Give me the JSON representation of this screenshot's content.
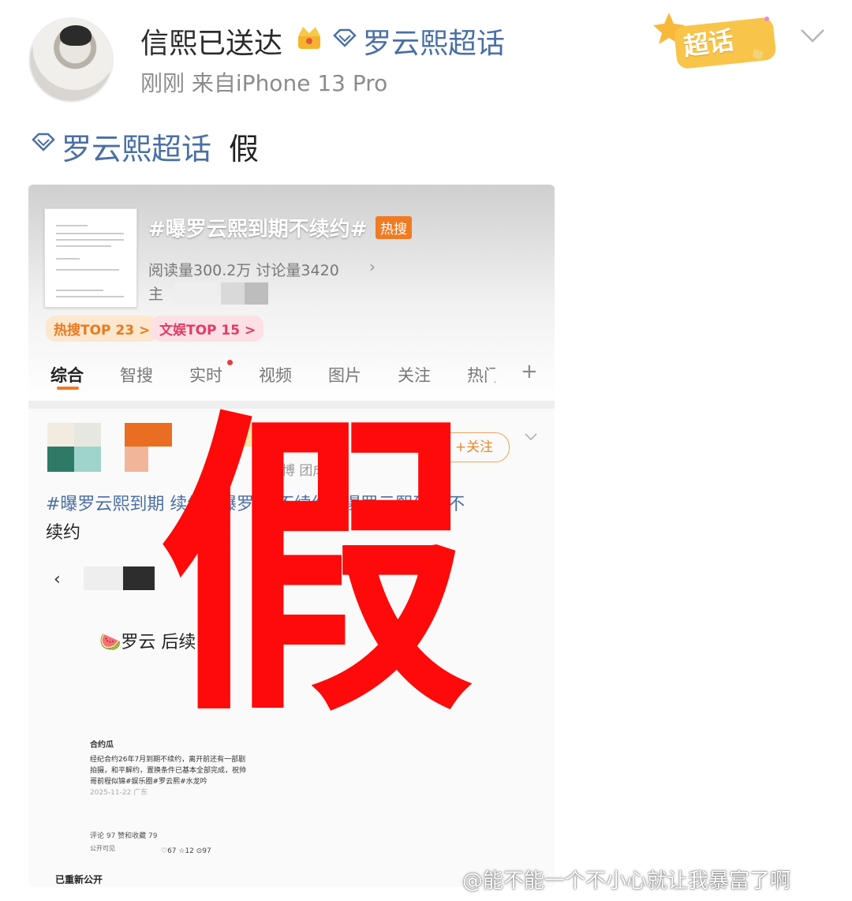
{
  "header": {
    "username": "信熙已送达",
    "topic_link": "罗云熙超话",
    "meta": "刚刚  来自iPhone 13 Pro",
    "badge_label": "超话"
  },
  "post": {
    "topic": "罗云熙超话",
    "text": "假"
  },
  "screenshot": {
    "hashtag": "#曝罗云熙到期不续约#",
    "hot_badge": "热搜",
    "stats": "阅读量300.2万  讨论量3420",
    "host_prefix": "主",
    "rank_hot": "热搜TOP 23 >",
    "rank_ent": "文娱TOP 15 >",
    "tabs": [
      "综合",
      "智搜",
      "实时",
      "视频",
      "图片",
      "关注",
      "热门"
    ],
    "follow_label": "+关注",
    "user_label": "微博 团成员",
    "tag_line_link": "#曝罗云熙到期 续约#曝罗 熙不续约#曝罗云熙到期不",
    "tag_line_tail": "续约",
    "inner_title": "🍉罗云 后续",
    "inner_heading": "合约瓜",
    "inner_body": "经纪合约26年7月到期不续约，离开前还有一部剧拍摄，和平解约，置换条件已基本全部完成，祝帅哥前程似锦#娱乐圈#罗云熙#水龙吟",
    "inner_date": "2025-11-22 广东",
    "inner_meta": "评论 97    赞和收藏 79",
    "inner_visibility": "公开可见",
    "inner_actions": "♡67   ☆12   ⊙97",
    "republished": "已重新公开"
  },
  "overlay_text": "假",
  "watermark": "@能不能一个不小心就让我暴富了啊",
  "colors": {
    "topic_blue": "#4a6fa5",
    "stamp_red": "#ff0a0a",
    "hot_orange": "#f07b23"
  }
}
